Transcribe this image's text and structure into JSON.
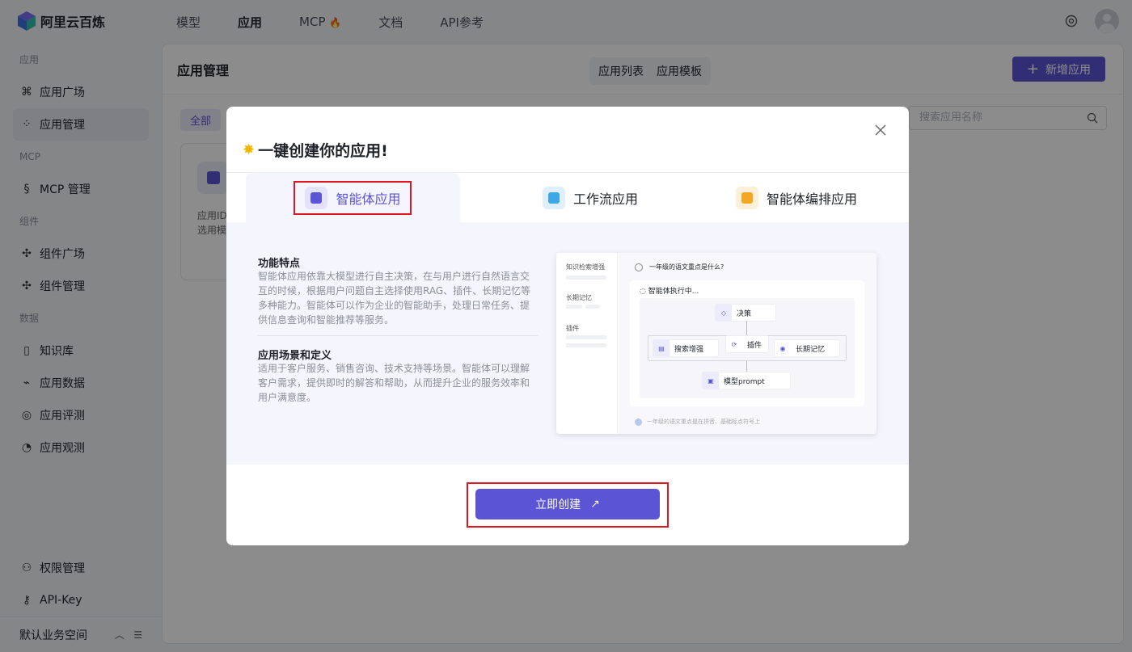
{
  "brand": {
    "name": "阿里云百炼"
  },
  "nav": {
    "items": [
      {
        "label": "模型",
        "active": false
      },
      {
        "label": "应用",
        "active": true
      },
      {
        "label": "MCP",
        "active": false
      },
      {
        "label": "文档",
        "active": false
      },
      {
        "label": "API参考",
        "active": false
      }
    ],
    "mcp_badge": "🔥"
  },
  "sidebar": {
    "sections": [
      {
        "title": "应用",
        "items": [
          "应用广场",
          "应用管理"
        ]
      },
      {
        "title": "MCP",
        "items": [
          "MCP 管理"
        ]
      },
      {
        "title": "组件",
        "items": [
          "组件广场",
          "组件管理"
        ]
      },
      {
        "title": "数据",
        "items": [
          "知识库",
          "应用数据",
          "应用评测",
          "应用观测"
        ]
      }
    ],
    "active_item": "应用管理",
    "bottom_items": [
      "权限管理",
      "API-Key"
    ],
    "workspace": "默认业务空间"
  },
  "main": {
    "title": "应用管理",
    "tabs": [
      "应用列表",
      "应用模板"
    ],
    "new_button": "新增应用",
    "filter_all": "全部",
    "search_placeholder": "搜索应用名称",
    "card_text_1": "应用ID",
    "card_text_2": "选用模"
  },
  "modal": {
    "title": "一键创建你的应用!",
    "tabs": [
      {
        "label": "智能体应用",
        "active": true,
        "color": "#5b54d4"
      },
      {
        "label": "工作流应用",
        "active": false,
        "color": "#3fa7e6"
      },
      {
        "label": "智能体编排应用",
        "active": false,
        "color": "#f5a623"
      }
    ],
    "features_title": "功能特点",
    "features_text": "智能体应用依靠大模型进行自主决策，在与用户进行自然语言交互的时候，根据用户问题自主选择使用RAG、插件、长期记忆等多种能力。智能体可以作为企业的智能助手，处理日常任务、提供信息查询和智能推荐等服务。",
    "scenes_title": "应用场景和定义",
    "scenes_text": "适用于客户服务、销售咨询、技术支持等场景。智能体可以理解客户需求，提供即时的解答和帮助，从而提升企业的服务效率和用户满意度。",
    "preview": {
      "side_labels": [
        "知识检索增强",
        "长期记忆",
        "插件"
      ],
      "question": "一年级的语文重点是什么?",
      "running": "智能体执行中...",
      "node_decision": "决策",
      "node_search": "搜索增强",
      "node_plugin": "插件",
      "node_memory": "长期记忆",
      "node_model": "模型prompt",
      "footer": "一年级的语文重点是在拼音、基础标点符号上"
    },
    "create_button": "立即创建"
  },
  "colors": {
    "accent": "#5b54d4",
    "highlight": "#e0161e"
  }
}
